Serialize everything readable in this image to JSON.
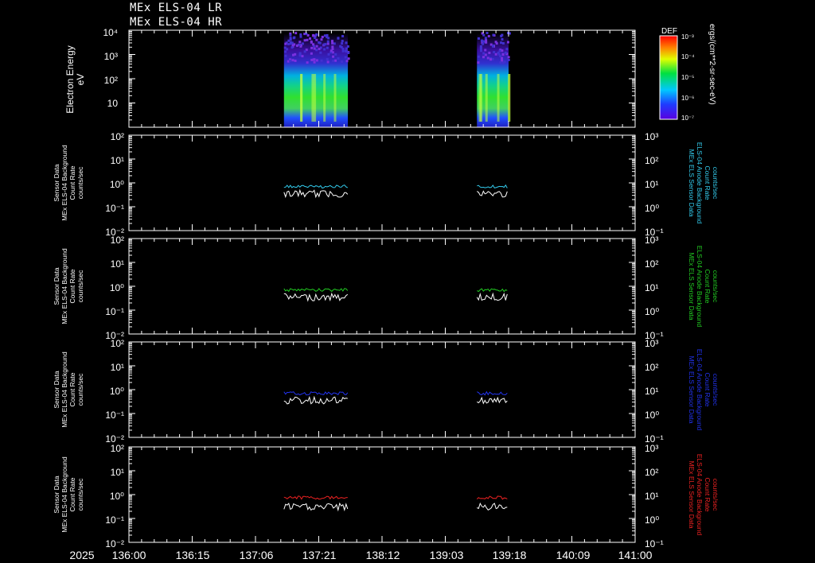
{
  "titles": [
    "MEx ELS-04 LR",
    "MEx ELS-04 HR"
  ],
  "colorbar": {
    "label_top": "DEF",
    "unit": "ergs/(cm**2-sr-sec-eV)",
    "ticks": [
      "10⁻³",
      "10⁻⁴",
      "10⁻⁵",
      "10⁻⁶",
      "10⁻⁷"
    ]
  },
  "x_axis": {
    "year": "2025",
    "ticks": [
      "136:00",
      "136:15",
      "137:06",
      "137:21",
      "138:12",
      "139:03",
      "139:18",
      "140:09",
      "141:00"
    ]
  },
  "panel1": {
    "ylabel": [
      "Electron Energy",
      "eV"
    ],
    "yticks": [
      "10⁴",
      "10³",
      "10²",
      "10",
      "1"
    ]
  },
  "line_panels": [
    {
      "left_label": [
        "Sensor Data",
        "MEx ELS-04 Background",
        "Count Rate",
        "counts/sec"
      ],
      "right_label": [
        "MEx ELS Sensor Data",
        "ELS-04 Anode Background",
        "Count Rate",
        "counts/sec"
      ],
      "left_ticks": [
        "10²",
        "10¹",
        "10⁰",
        "10⁻¹",
        "10⁻²"
      ],
      "right_ticks": [
        "10³",
        "10²",
        "10¹",
        "10⁰",
        "10⁻¹"
      ],
      "color": "#33ccee"
    },
    {
      "left_label": [
        "Sensor Data",
        "MEx ELS-04 Background",
        "Count Rate",
        "counts/sec"
      ],
      "right_label": [
        "MEx ELS Sensor Data",
        "ELS-04 Anode Background",
        "Count Rate",
        "counts/sec"
      ],
      "left_ticks": [
        "10²",
        "10¹",
        "10⁰",
        "10⁻¹",
        "10⁻²"
      ],
      "right_ticks": [
        "10³",
        "10²",
        "10¹",
        "10⁰",
        "10⁻¹"
      ],
      "color": "#22cc22"
    },
    {
      "left_label": [
        "Sensor Data",
        "MEx ELS-04 Background",
        "Count Rate",
        "counts/sec"
      ],
      "right_label": [
        "MEx ELS Sensor Data",
        "ELS-04 Anode Background",
        "Count Rate",
        "counts/sec"
      ],
      "left_ticks": [
        "10²",
        "10¹",
        "10⁰",
        "10⁻¹",
        "10⁻²"
      ],
      "right_ticks": [
        "10³",
        "10²",
        "10¹",
        "10⁰",
        "10⁻¹"
      ],
      "color": "#2233ee"
    },
    {
      "left_label": [
        "Sensor Data",
        "MEx ELS-04 Background",
        "Count Rate",
        "counts/sec"
      ],
      "right_label": [
        "MEx ELS Sensor Data",
        "ELS-04 Anode Background",
        "Count Rate",
        "counts/sec"
      ],
      "left_ticks": [
        "10²",
        "10¹",
        "10⁰",
        "10⁻¹",
        "10⁻²"
      ],
      "right_ticks": [
        "10³",
        "10²",
        "10¹",
        "10⁰",
        "10⁻¹"
      ],
      "color": "#ee2222"
    }
  ],
  "chart_data": {
    "type": "line",
    "x_ticks": [
      "136:00",
      "136:15",
      "137:06",
      "137:21",
      "138:12",
      "139:03",
      "139:18",
      "140:09",
      "141:00"
    ],
    "data_intervals": [
      {
        "start": "137:02",
        "end": "137:30"
      },
      {
        "start": "139:09",
        "end": "139:21"
      }
    ],
    "spectrogram": {
      "ylabel": "Electron Energy eV",
      "ylim": [
        1,
        10000
      ],
      "yscale": "log",
      "colorbar_label": "DEF ergs/(cm**2-sr-sec-eV)",
      "colorbar_range": [
        1e-07,
        0.001
      ]
    },
    "background_panels": [
      {
        "anode_series_level": 0.7,
        "white_series_level": 0.4,
        "ylim_left": [
          0.01,
          100
        ],
        "ylim_right": [
          0.1,
          1000
        ],
        "yscale": "log"
      },
      {
        "anode_series_level": 0.7,
        "white_series_level": 0.4,
        "ylim_left": [
          0.01,
          100
        ],
        "ylim_right": [
          0.1,
          1000
        ],
        "yscale": "log"
      },
      {
        "anode_series_level": 0.7,
        "white_series_level": 0.4,
        "ylim_left": [
          0.01,
          100
        ],
        "ylim_right": [
          0.1,
          1000
        ],
        "yscale": "log"
      },
      {
        "anode_series_level": 0.75,
        "white_series_level": 0.35,
        "ylim_left": [
          0.01,
          100
        ],
        "ylim_right": [
          0.1,
          1000
        ],
        "yscale": "log"
      }
    ]
  }
}
